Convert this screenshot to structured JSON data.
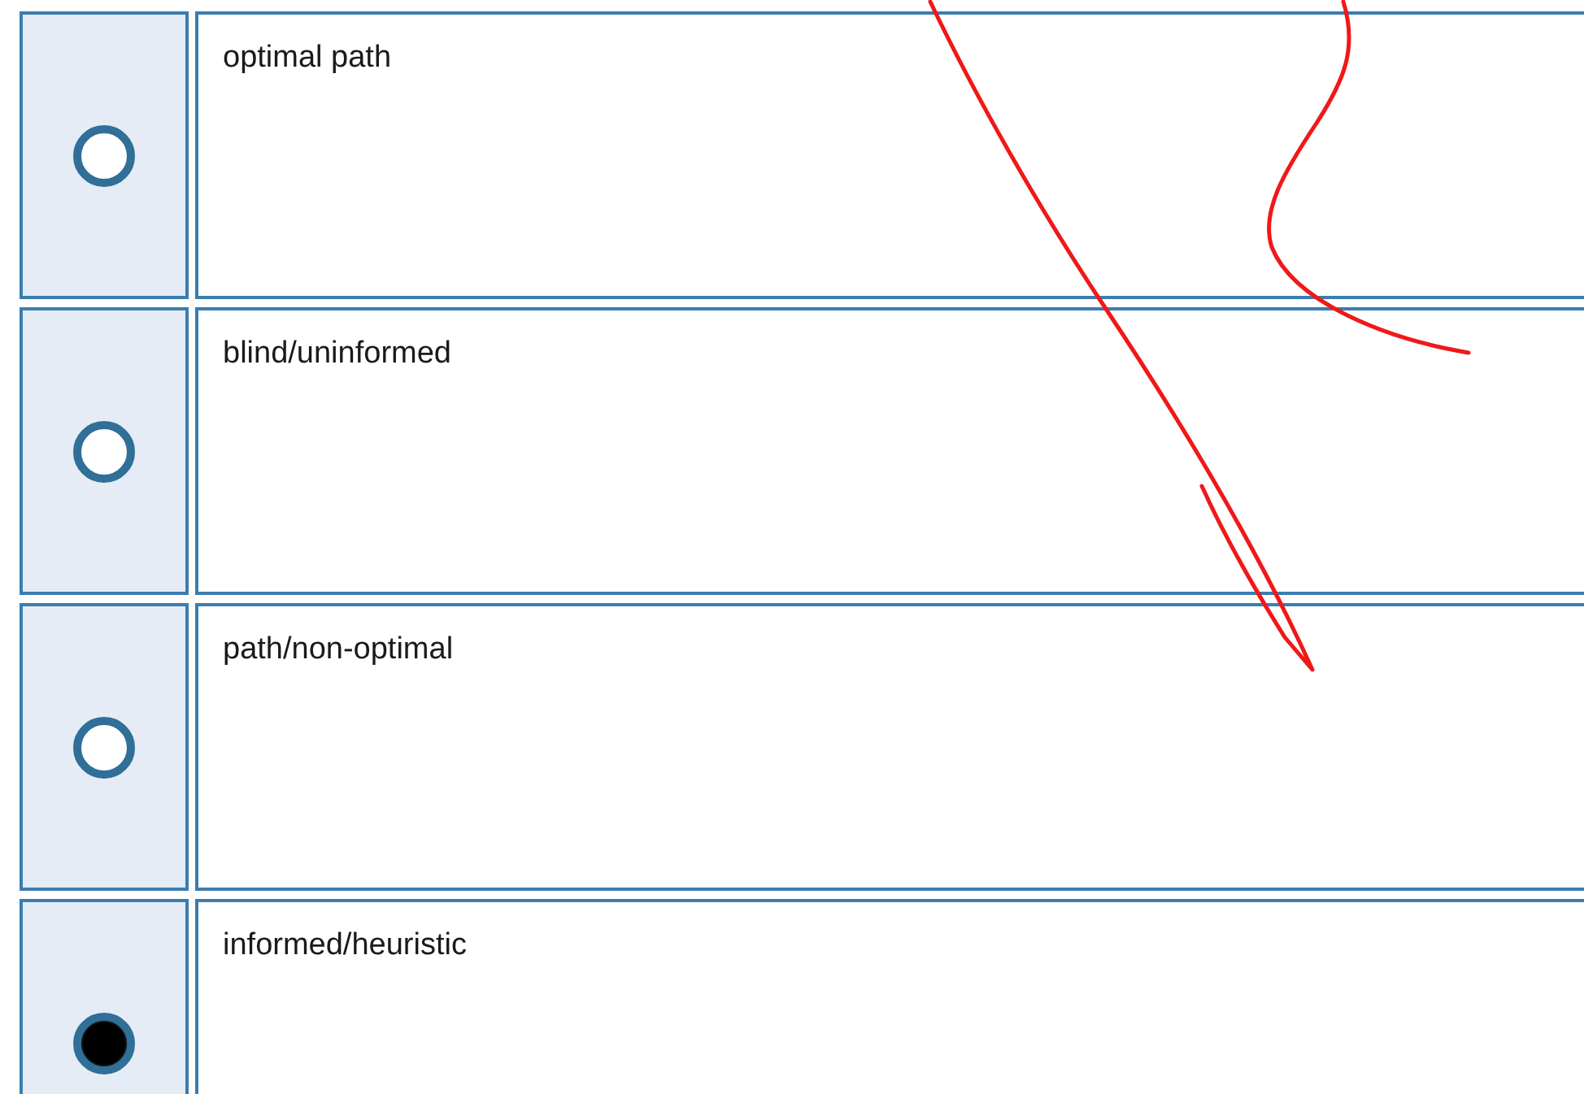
{
  "options": [
    {
      "label": "optimal path",
      "selected": false
    },
    {
      "label": "blind/uninformed",
      "selected": false
    },
    {
      "label": "path/non-optimal",
      "selected": false
    },
    {
      "label": "informed/heuristic",
      "selected": true
    }
  ]
}
